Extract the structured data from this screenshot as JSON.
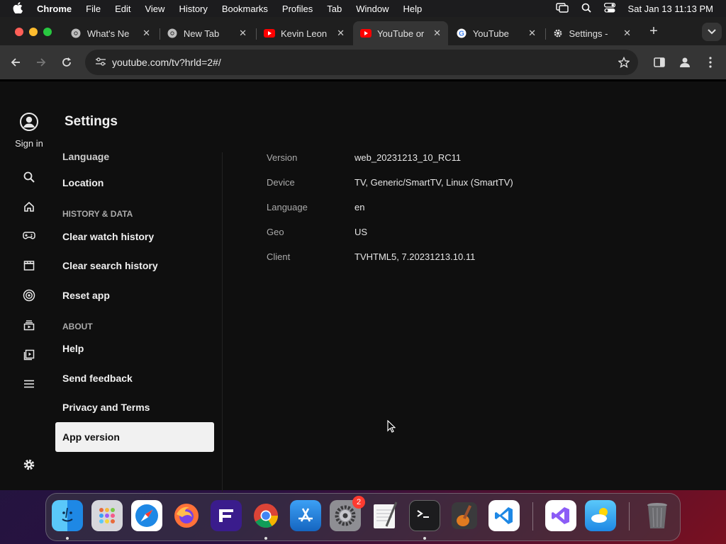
{
  "menubar": {
    "app": "Chrome",
    "items": [
      "File",
      "Edit",
      "View",
      "History",
      "Bookmarks",
      "Profiles",
      "Tab",
      "Window",
      "Help"
    ],
    "datetime": "Sat Jan 13  11:13 PM"
  },
  "tabs": [
    {
      "title": "What's Ne",
      "icon": "chrome-icon"
    },
    {
      "title": "New Tab",
      "icon": "chrome-icon"
    },
    {
      "title": "Kevin Leon",
      "icon": "youtube-icon"
    },
    {
      "title": "YouTube or",
      "icon": "youtube-icon",
      "active": true
    },
    {
      "title": "YouTube",
      "icon": "google-icon"
    },
    {
      "title": "Settings - ",
      "icon": "gear-icon"
    }
  ],
  "toolbar": {
    "url": "youtube.com/tv?hrld=2#/"
  },
  "page": {
    "title": "Settings",
    "sign_in": "Sign in",
    "menu": {
      "partial_top": "Language",
      "location": "Location",
      "history_section": "HISTORY & DATA",
      "clear_watch": "Clear watch history",
      "clear_search": "Clear search history",
      "reset": "Reset app",
      "about_section": "ABOUT",
      "help": "Help",
      "feedback": "Send feedback",
      "privacy": "Privacy and Terms",
      "app_version": "App version"
    },
    "info": [
      {
        "key": "Version",
        "value": "web_20231213_10_RC11"
      },
      {
        "key": "Device",
        "value": "TV, Generic/SmartTV, Linux (SmartTV)"
      },
      {
        "key": "Language",
        "value": "en"
      },
      {
        "key": "Geo",
        "value": "US"
      },
      {
        "key": "Client",
        "value": "TVHTML5, 7.20231213.10.11"
      }
    ]
  },
  "dock": {
    "settings_badge": "2"
  },
  "colors": {
    "background": "#0f0f0f",
    "selected_item": "#f1f1f1",
    "youtube_red": "#ff0000"
  }
}
